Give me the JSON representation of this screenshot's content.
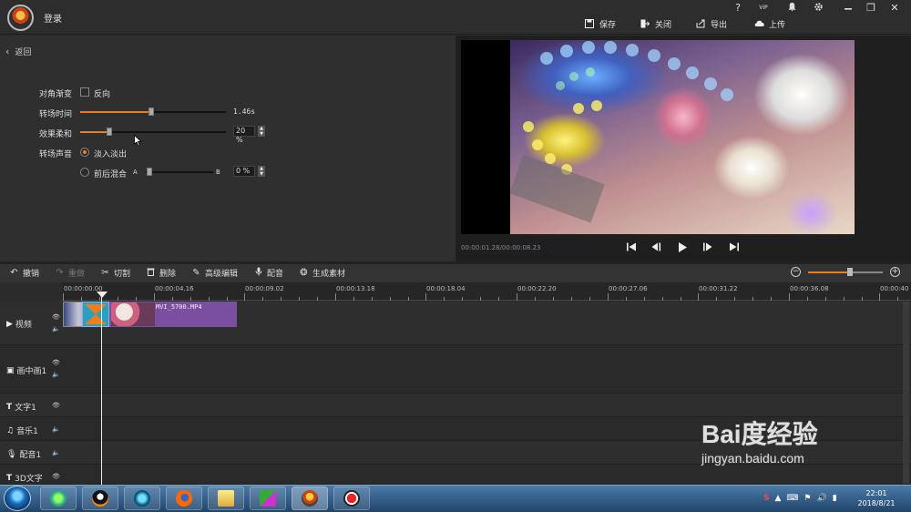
{
  "titlebar": {
    "login_label": "登录",
    "window_icons": {
      "help": "?",
      "vip": "VIP",
      "bell": "bell-icon",
      "gear": "gear-icon",
      "restore": "❐",
      "close": "✕"
    },
    "actions": {
      "save": "保存",
      "close": "关闭",
      "export": "导出",
      "upload": "上传"
    }
  },
  "settings": {
    "back_label": "返回",
    "diagonal_label": "对角渐变",
    "reverse_label": "反向",
    "reverse_checked": false,
    "duration_label": "转场时间",
    "duration_value": "1.46s",
    "duration_fraction": 0.49,
    "softness_label": "效果柔和",
    "softness_value": "20 %",
    "softness_fraction": 0.2,
    "sound_label": "转场声音",
    "sound_options": {
      "fade": "淡入淡出",
      "mix": "前后混合"
    },
    "sound_selected": "fade",
    "mix_a": "A",
    "mix_b": "B",
    "mix_value": "0 %"
  },
  "preview": {
    "timecode": "00:00:01.28/00:00:08.23",
    "controls": [
      "skip-start",
      "prev-frame",
      "play",
      "next-frame",
      "skip-end"
    ]
  },
  "toolbar": {
    "undo": "撤销",
    "redo": "重做",
    "cut": "切割",
    "delete": "删除",
    "advanced": "高级编辑",
    "dub": "配音",
    "generate": "生成素材",
    "zoom_fraction": 0.56
  },
  "ruler": {
    "labels": [
      "00:00:00.00",
      "00:00:04.16",
      "00:00:09.02",
      "00:00:13.18",
      "00:00:18.04",
      "00:00:22.20",
      "00:00:27.06",
      "00:00:31.22",
      "00:00:36.08",
      "00:00:40"
    ]
  },
  "tracks": {
    "video": "视频",
    "pip": "画中画1",
    "text": "文字1",
    "music": "音乐1",
    "dub": "配音1",
    "text3d": "3D文字"
  },
  "clip": {
    "name": "MVI_5700.MP4"
  },
  "taskbar": {
    "time": "22:01",
    "date": "2018/8/21",
    "tray_ime": "S"
  },
  "watermark": {
    "brand": "Bai度经验",
    "url": "jingyan.baidu.com"
  },
  "colors": {
    "accent": "#f07c1c",
    "clip": "#7b4fa0",
    "transition": "#2aa0c0"
  }
}
